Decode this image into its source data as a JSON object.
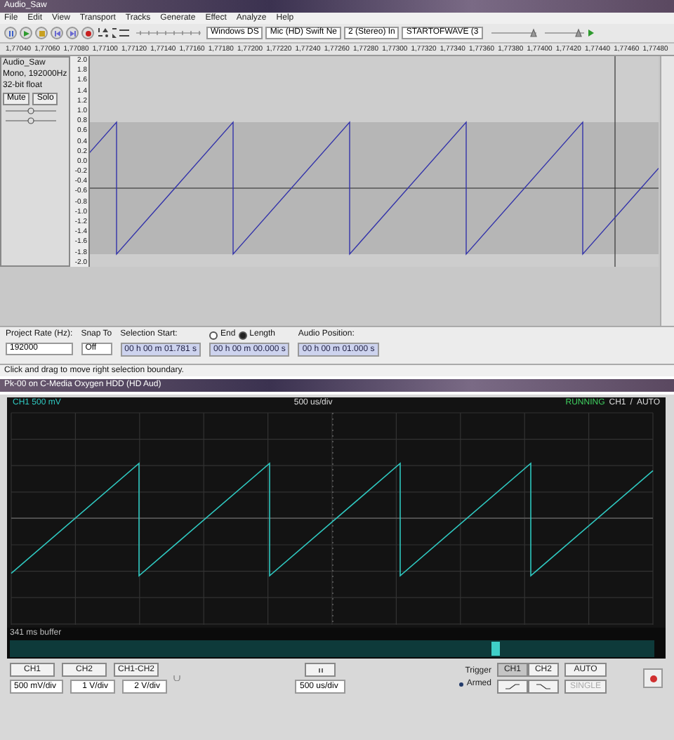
{
  "audacity": {
    "title": "Audio_Saw",
    "menu": [
      "File",
      "Edit",
      "View",
      "Transport",
      "Tracks",
      "Generate",
      "Effect",
      "Analyze",
      "Help"
    ],
    "transport": [
      {
        "kind": "pause"
      },
      {
        "kind": "play"
      },
      {
        "kind": "stop"
      },
      {
        "kind": "start"
      },
      {
        "kind": "end"
      },
      {
        "kind": "record"
      }
    ],
    "devices": [
      "Windows DS",
      "Mic (HD) Swift Ne",
      "2 (Stereo) In",
      "STARTOFWAVE (3"
    ],
    "ruler": [
      "1,77040",
      "1,77060",
      "1,77080",
      "1,77100",
      "1,77120",
      "1,77140",
      "1,77160",
      "1,77180",
      "1,77200",
      "1,77220",
      "1,77240",
      "1,77260",
      "1,77280",
      "1,77300",
      "1,77320",
      "1,77340",
      "1,77360",
      "1,77380",
      "1,77400",
      "1,77420",
      "1,77440",
      "1,77460",
      "1,77480"
    ],
    "track": {
      "name": "Audio_Saw",
      "info": [
        "Mono, 192000Hz",
        "32-bit float"
      ],
      "buttons": [
        "Mute",
        "Solo"
      ],
      "sliders": [
        {
          "level": 0.5
        },
        {
          "level": 0.5
        }
      ]
    },
    "scale": [
      "2.0",
      "1.8",
      "1.6",
      "1.4",
      "1.2",
      "1.0",
      "0.8",
      "0.6",
      "0.4",
      "0.2",
      "0.0",
      "-0.2",
      "-0.4",
      "-0.6",
      "-0.8",
      "-1.0",
      "-1.2",
      "-1.4",
      "-1.6",
      "-1.8",
      "-2.0"
    ],
    "selection_bar": {
      "rate_label": "Project Rate (Hz):",
      "rate": "192000",
      "snap_label": "Snap To",
      "snap": "Off",
      "start_label": "Selection Start:",
      "start": "00 h 00 m 01.781 s",
      "end_options": [
        {
          "label": "End",
          "selected": false
        },
        {
          "label": "Length",
          "selected": true
        }
      ],
      "length": "00 h 00 m 00.000 s",
      "position_label": "Audio Position:",
      "position": "00 h 00 m 01.000 s"
    },
    "status": "Click and drag to move right selection boundary."
  },
  "scope": {
    "title": "Pk-00 on C-Media Oxygen HDD (HD Aud)",
    "header": {
      "channel": "CH1 500 mV",
      "timebase": "500 us/div",
      "state": "RUNNING",
      "trigger_channel": "CH1",
      "separator": "/",
      "mode": "AUTO"
    },
    "buffer": "341 ms buffer",
    "channel_buttons": [
      "CH1",
      "CH2",
      "CH1-CH2"
    ],
    "volts": [
      "500 mV/div",
      "1 V/div",
      "2 V/div"
    ],
    "timebase": "500 us/div",
    "trigger": {
      "label": "Trigger",
      "status": "Armed",
      "channels": [
        {
          "label": "CH1",
          "selected": true
        },
        {
          "label": "CH2",
          "selected": false
        }
      ],
      "mode": "AUTO",
      "single": {
        "label": "SINGLE",
        "disabled": true
      }
    }
  }
}
